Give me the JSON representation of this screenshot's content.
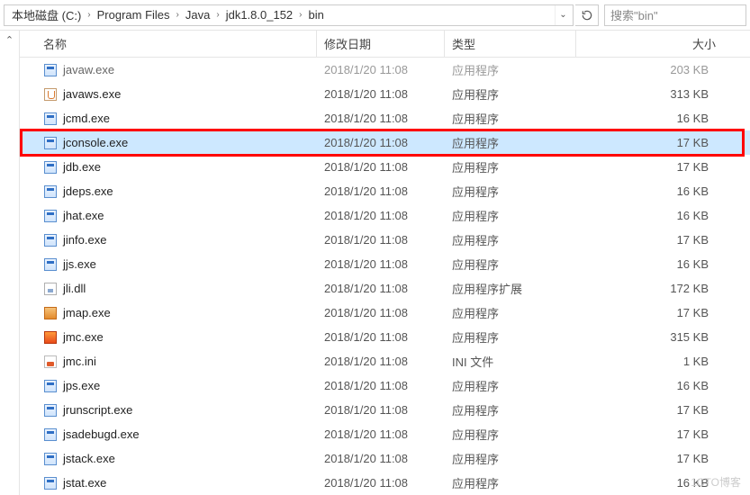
{
  "breadcrumb": {
    "segments": [
      "本地磁盘 (C:)",
      "Program Files",
      "Java",
      "jdk1.8.0_152",
      "bin"
    ]
  },
  "search": {
    "placeholder": "搜索\"bin\""
  },
  "columns": {
    "name": "名称",
    "date": "修改日期",
    "type": "类型",
    "size": "大小"
  },
  "selected_index": 3,
  "highlighted_index": 3,
  "files": [
    {
      "name": "javaw.exe",
      "date": "2018/1/20 11:08",
      "type": "应用程序",
      "size": "203 KB",
      "icon": "exe",
      "faded": true
    },
    {
      "name": "javaws.exe",
      "date": "2018/1/20 11:08",
      "type": "应用程序",
      "size": "313 KB",
      "icon": "java"
    },
    {
      "name": "jcmd.exe",
      "date": "2018/1/20 11:08",
      "type": "应用程序",
      "size": "16 KB",
      "icon": "exe"
    },
    {
      "name": "jconsole.exe",
      "date": "2018/1/20 11:08",
      "type": "应用程序",
      "size": "17 KB",
      "icon": "exe"
    },
    {
      "name": "jdb.exe",
      "date": "2018/1/20 11:08",
      "type": "应用程序",
      "size": "17 KB",
      "icon": "exe"
    },
    {
      "name": "jdeps.exe",
      "date": "2018/1/20 11:08",
      "type": "应用程序",
      "size": "16 KB",
      "icon": "exe"
    },
    {
      "name": "jhat.exe",
      "date": "2018/1/20 11:08",
      "type": "应用程序",
      "size": "16 KB",
      "icon": "exe"
    },
    {
      "name": "jinfo.exe",
      "date": "2018/1/20 11:08",
      "type": "应用程序",
      "size": "17 KB",
      "icon": "exe"
    },
    {
      "name": "jjs.exe",
      "date": "2018/1/20 11:08",
      "type": "应用程序",
      "size": "16 KB",
      "icon": "exe"
    },
    {
      "name": "jli.dll",
      "date": "2018/1/20 11:08",
      "type": "应用程序扩展",
      "size": "172 KB",
      "icon": "dll"
    },
    {
      "name": "jmap.exe",
      "date": "2018/1/20 11:08",
      "type": "应用程序",
      "size": "17 KB",
      "icon": "jmap"
    },
    {
      "name": "jmc.exe",
      "date": "2018/1/20 11:08",
      "type": "应用程序",
      "size": "315 KB",
      "icon": "jmc"
    },
    {
      "name": "jmc.ini",
      "date": "2018/1/20 11:08",
      "type": "INI 文件",
      "size": "1 KB",
      "icon": "jmc-ini"
    },
    {
      "name": "jps.exe",
      "date": "2018/1/20 11:08",
      "type": "应用程序",
      "size": "16 KB",
      "icon": "exe"
    },
    {
      "name": "jrunscript.exe",
      "date": "2018/1/20 11:08",
      "type": "应用程序",
      "size": "17 KB",
      "icon": "exe"
    },
    {
      "name": "jsadebugd.exe",
      "date": "2018/1/20 11:08",
      "type": "应用程序",
      "size": "17 KB",
      "icon": "exe"
    },
    {
      "name": "jstack.exe",
      "date": "2018/1/20 11:08",
      "type": "应用程序",
      "size": "17 KB",
      "icon": "exe"
    },
    {
      "name": "jstat.exe",
      "date": "2018/1/20 11:08",
      "type": "应用程序",
      "size": "16 KB",
      "icon": "exe"
    }
  ],
  "watermark": "1CTO博客"
}
